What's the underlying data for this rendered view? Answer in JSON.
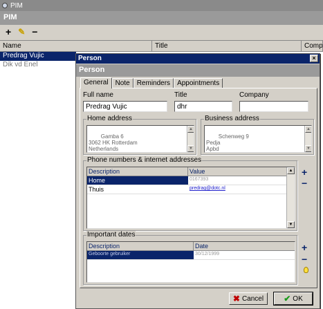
{
  "window": {
    "title": "PIM"
  },
  "main": {
    "header": "PIM",
    "toolbar": {
      "add": "+",
      "edit": "✎",
      "remove": "−"
    },
    "columns": [
      "Name",
      "Title",
      "Company"
    ],
    "rows": [
      {
        "name": "Predrag Vujic"
      },
      {
        "name": "Dik vd Enel"
      }
    ]
  },
  "dialog": {
    "title": "Person",
    "header": "Person",
    "close": "×",
    "tabs": [
      "General",
      "Note",
      "Reminders",
      "Appointments"
    ],
    "general": {
      "fullname_label": "Full name",
      "fullname": "Predrag Vujic",
      "title_label": "Title",
      "title": "dhr",
      "company_label": "Company",
      "company": "",
      "home_label": "Home address",
      "home_address": "Gamba 6\n3062 HK Rotterdam\nNetherlands",
      "business_label": "Business address",
      "business_address": "Schenweg 9\nPedja\nApbd",
      "phone_label": "Phone numbers & internet addresses",
      "phone_columns": [
        "Description",
        "Value"
      ],
      "phone_rows": [
        {
          "description": "Home",
          "value": "0167393"
        },
        {
          "description": "Thuis",
          "value": "predrag@dotc.nl"
        }
      ],
      "dates_label": "Important dates",
      "dates_columns": [
        "Description",
        "Date"
      ],
      "dates_rows": [
        {
          "description": "Geboorte gebruiker",
          "date": "30/12/1999"
        }
      ]
    },
    "buttons": {
      "cancel": "Cancel",
      "ok": "OK"
    }
  },
  "colors": {
    "selection": "#0a246a",
    "title_bar": "#8a8a8a",
    "header": "#9a9a9a"
  }
}
